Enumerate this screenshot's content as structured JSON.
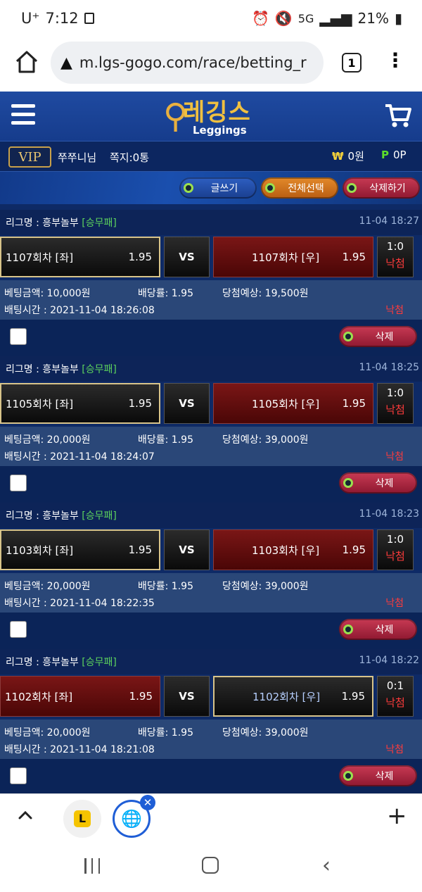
{
  "status": {
    "carrier": "U⁺",
    "time": "7:12",
    "battery": "21%",
    "net": "5G"
  },
  "browser": {
    "url": "m.lgs-gogo.com/race/betting_r",
    "tab_count": "1"
  },
  "site": {
    "logo_kor": "레깅스",
    "logo_eng": "Leggings",
    "vip": "VIP",
    "username": "쭈쭈니님",
    "memo": "쪽지:0통",
    "won_symbol": "₩",
    "money": "0원",
    "point_symbol": "P",
    "points": "0P",
    "actions": {
      "write": "글쓰기",
      "select_all": "전체선택",
      "delete_all": "삭제하기"
    }
  },
  "bets": [
    {
      "league": "리그명 : 흥부놀부",
      "tag": "[승무패]",
      "time": "11-04 18:27",
      "home": "1107회차 [좌]",
      "home_odds": "1.95",
      "vs": "VS",
      "away": "1107회차 [우]",
      "away_odds": "1.95",
      "score": "1:0",
      "result": "낙첨",
      "amount": "베팅금액: 10,000원",
      "rate": "배당률: 1.95",
      "expected": "당첨예상: 19,500원",
      "bettime": "배팅시간 : 2021-11-04 18:26:08",
      "status": "낙첨",
      "delete": "삭제"
    },
    {
      "league": "리그명 : 흥부놀부",
      "tag": "[승무패]",
      "time": "11-04 18:25",
      "home": "1105회차 [좌]",
      "home_odds": "1.95",
      "vs": "VS",
      "away": "1105회차 [우]",
      "away_odds": "1.95",
      "score": "1:0",
      "result": "낙첨",
      "amount": "베팅금액: 20,000원",
      "rate": "배당률: 1.95",
      "expected": "당첨예상: 39,000원",
      "bettime": "배팅시간 : 2021-11-04 18:24:07",
      "status": "낙첨",
      "delete": "삭제"
    },
    {
      "league": "리그명 : 흥부놀부",
      "tag": "[승무패]",
      "time": "11-04 18:23",
      "home": "1103회차 [좌]",
      "home_odds": "1.95",
      "vs": "VS",
      "away": "1103회차 [우]",
      "away_odds": "1.95",
      "score": "1:0",
      "result": "낙첨",
      "amount": "베팅금액: 20,000원",
      "rate": "배당률: 1.95",
      "expected": "당첨예상: 39,000원",
      "bettime": "배팅시간 : 2021-11-04 18:22:35",
      "status": "낙첨",
      "delete": "삭제"
    },
    {
      "league": "리그명 : 흥부놀부",
      "tag": "[승무패]",
      "time": "11-04 18:22",
      "home": "1102회차 [좌]",
      "home_odds": "1.95",
      "vs": "VS",
      "away": "1102회차 [우]",
      "away_odds": "1.95",
      "score": "0:1",
      "result": "낙첨",
      "amount": "베팅금액: 20,000원",
      "rate": "배당률: 1.95",
      "expected": "당첨예상: 39,000원",
      "bettime": "배팅시간 : 2021-11-04 18:21:08",
      "status": "낙첨",
      "delete": "삭제"
    }
  ],
  "bottom": {
    "tab1_letter": "L"
  },
  "colors": {
    "site_bg": "#0e2a66",
    "accent_gold": "#f0c040",
    "loss_red": "#ff3b3b",
    "tag_green": "#5dd35d"
  }
}
